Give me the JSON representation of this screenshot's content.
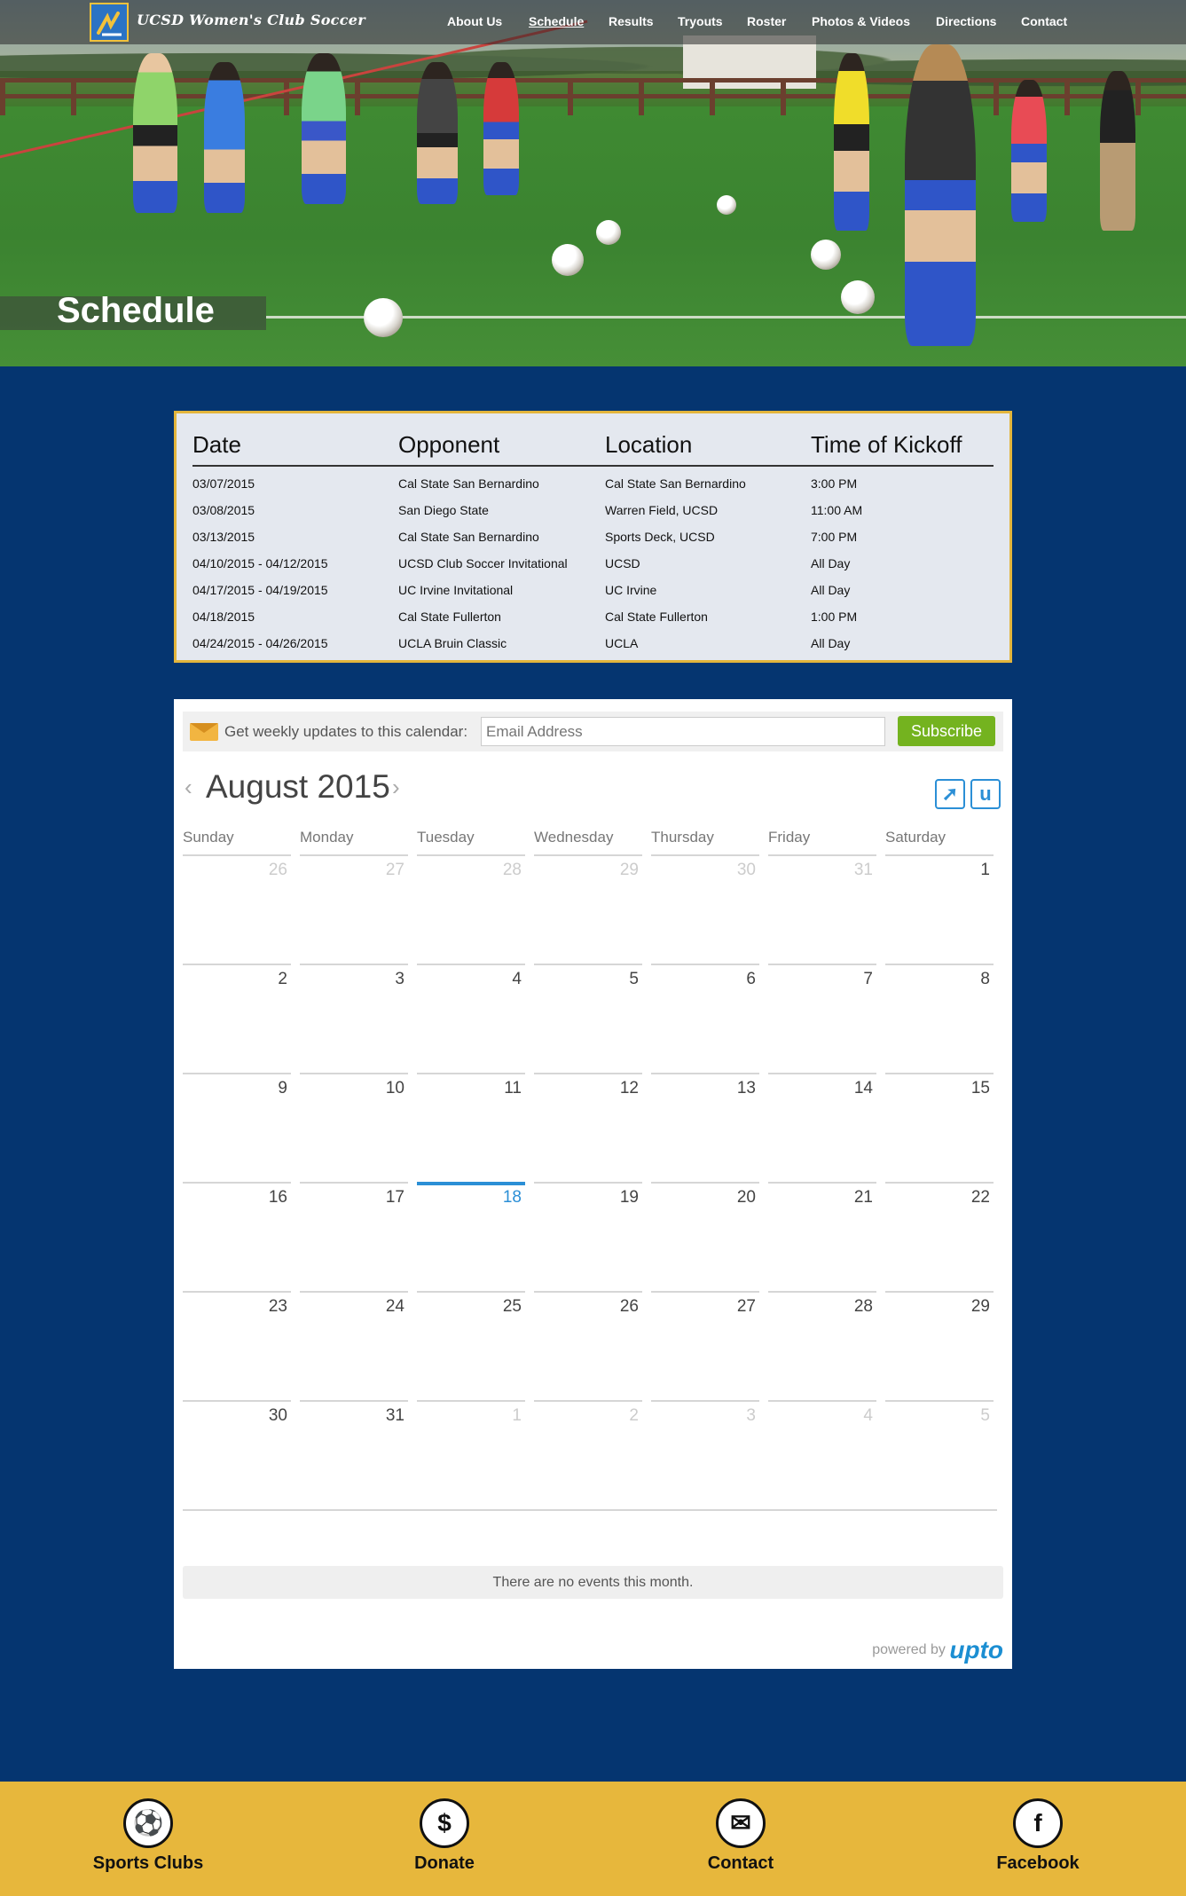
{
  "header": {
    "logo_text": "UCSD Women's Club Soccer",
    "nav": [
      "About Us",
      "Schedule",
      "Results",
      "Tryouts",
      "Roster",
      "Photos & Videos",
      "Directions",
      "Contact"
    ],
    "active_nav": "Schedule",
    "page_title": "Schedule"
  },
  "schedule": {
    "columns": [
      "Date",
      "Opponent",
      "Location",
      "Time of Kickoff"
    ],
    "rows": [
      [
        "03/07/2015",
        "Cal State San Bernardino",
        "Cal State San Bernardino",
        "3:00 PM"
      ],
      [
        "03/08/2015",
        "San Diego State",
        "Warren Field, UCSD",
        "11:00 AM"
      ],
      [
        "03/13/2015",
        "Cal State San Bernardino",
        "Sports Deck, UCSD",
        "7:00 PM"
      ],
      [
        "04/10/2015 - 04/12/2015",
        "UCSD Club Soccer Invitational",
        "UCSD",
        "All Day"
      ],
      [
        "04/17/2015 - 04/19/2015",
        "UC Irvine Invitational",
        "UC Irvine",
        "All Day"
      ],
      [
        "04/18/2015",
        "Cal State Fullerton",
        "Cal State Fullerton",
        "1:00 PM"
      ],
      [
        "04/24/2015 - 04/26/2015",
        "UCLA Bruin Classic",
        "UCLA",
        "All Day"
      ]
    ]
  },
  "calendar": {
    "subscribe_label": "Get weekly updates to this calendar:",
    "email_placeholder": "Email Address",
    "subscribe_button": "Subscribe",
    "month_title": "August 2015",
    "prev_glyph": "‹",
    "next_glyph": "›",
    "share_glyph": "➚",
    "upto_glyph": "u",
    "weekdays": [
      "Sunday",
      "Monday",
      "Tuesday",
      "Wednesday",
      "Thursday",
      "Friday",
      "Saturday"
    ],
    "weeks": [
      [
        "26",
        "27",
        "28",
        "29",
        "30",
        "31",
        "1"
      ],
      [
        "2",
        "3",
        "4",
        "5",
        "6",
        "7",
        "8"
      ],
      [
        "9",
        "10",
        "11",
        "12",
        "13",
        "14",
        "15"
      ],
      [
        "16",
        "17",
        "18",
        "19",
        "20",
        "21",
        "22"
      ],
      [
        "23",
        "24",
        "25",
        "26",
        "27",
        "28",
        "29"
      ],
      [
        "30",
        "31",
        "1",
        "2",
        "3",
        "4",
        "5"
      ]
    ],
    "today": "18",
    "no_events": "There are no events this month.",
    "powered_by": "powered by",
    "powered_brand": "upto"
  },
  "footer": {
    "items": [
      {
        "label": "Sports Clubs",
        "icon": "soccer-ball-icon",
        "glyph": "⚽"
      },
      {
        "label": "Donate",
        "icon": "dollar-icon",
        "glyph": "$"
      },
      {
        "label": "Contact",
        "icon": "envelope-icon",
        "glyph": "✉"
      },
      {
        "label": "Facebook",
        "icon": "facebook-icon",
        "glyph": "f"
      }
    ]
  },
  "colors": {
    "page_bg": "#053570",
    "table_border": "#e3b53c",
    "subscribe_green": "#74b31f",
    "accent_blue": "#2b8fd6",
    "footer_bg": "#e7b73c"
  }
}
